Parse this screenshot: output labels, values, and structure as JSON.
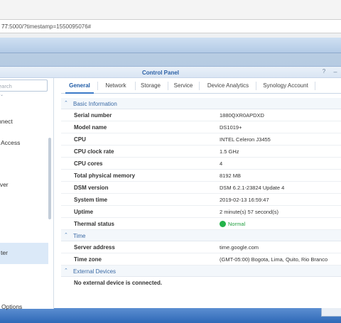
{
  "browser": {
    "url_prefix": "77",
    "url_rest": ":5000/?timestamp=1550095076#"
  },
  "window": {
    "title": "Control Panel",
    "help_glyph": "?",
    "min_glyph": "–"
  },
  "sidebar": {
    "search_placeholder": "earch",
    "items": [
      {
        "label": "nnect"
      },
      {
        "label": "Access"
      },
      {
        "label": "rver"
      },
      {
        "label": "ter",
        "active": true
      },
      {
        "label": "Options"
      }
    ]
  },
  "tabs": [
    {
      "label": "General",
      "active": true
    },
    {
      "label": "Network"
    },
    {
      "label": "Storage"
    },
    {
      "label": "Service"
    },
    {
      "label": "Device Analytics"
    },
    {
      "label": "Synology Account"
    }
  ],
  "sections": {
    "basic": {
      "title": "Basic Information",
      "rows": [
        {
          "key": "Serial number",
          "value": "1880QXR0APDXD"
        },
        {
          "key": "Model name",
          "value": "DS1019+"
        },
        {
          "key": "CPU",
          "value": "INTEL Celeron J3455"
        },
        {
          "key": "CPU clock rate",
          "value": "1.5 GHz"
        },
        {
          "key": "CPU cores",
          "value": "4"
        },
        {
          "key": "Total physical memory",
          "value": "8192 MB"
        },
        {
          "key": "DSM version",
          "value": "DSM 6.2.1-23824 Update 4"
        },
        {
          "key": "System time",
          "value": "2019-02-13 16:59:47"
        },
        {
          "key": "Uptime",
          "value": "2 minute(s) 57 second(s)"
        },
        {
          "key": "Thermal status",
          "value": "Normal"
        }
      ]
    },
    "time": {
      "title": "Time",
      "rows": [
        {
          "key": "Server address",
          "value": "time.google.com"
        },
        {
          "key": "Time zone",
          "value": "(GMT-05:00) Bogota, Lima, Quito, Rio Branco"
        }
      ]
    },
    "external": {
      "title": "External Devices",
      "message": "No external device is connected."
    }
  },
  "colors": {
    "accent": "#3a79c8",
    "status_ok": "#23b34a"
  }
}
